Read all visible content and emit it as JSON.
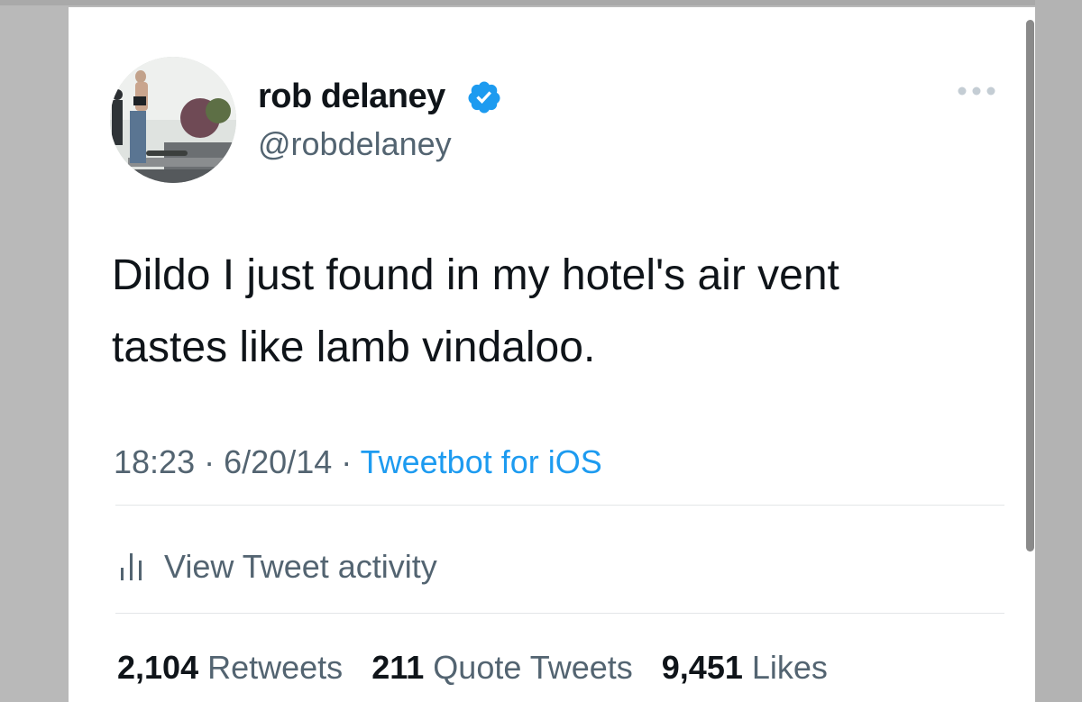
{
  "author": {
    "display_name": "rob delaney",
    "handle": "@robdelaney",
    "verified": true,
    "avatar_icon": "profile-photo"
  },
  "tweet": {
    "text_lines": [
      "Dildo I just found in my hotel's air vent",
      "tastes like lamb vindaloo."
    ],
    "time": "18:23",
    "date": "6/20/14",
    "separator": "·",
    "source": "Tweetbot for iOS"
  },
  "activity": {
    "icon": "bar-chart-icon",
    "label": "View Tweet activity"
  },
  "stats": {
    "retweets_count": "2,104",
    "retweets_label": "Retweets",
    "quotes_count": "211",
    "quotes_label": "Quote Tweets",
    "likes_count": "9,451",
    "likes_label": "Likes"
  },
  "colors": {
    "text": "#0f1419",
    "secondary": "#536471",
    "link": "#1d9bf0",
    "verified": "#1d9bf0"
  }
}
